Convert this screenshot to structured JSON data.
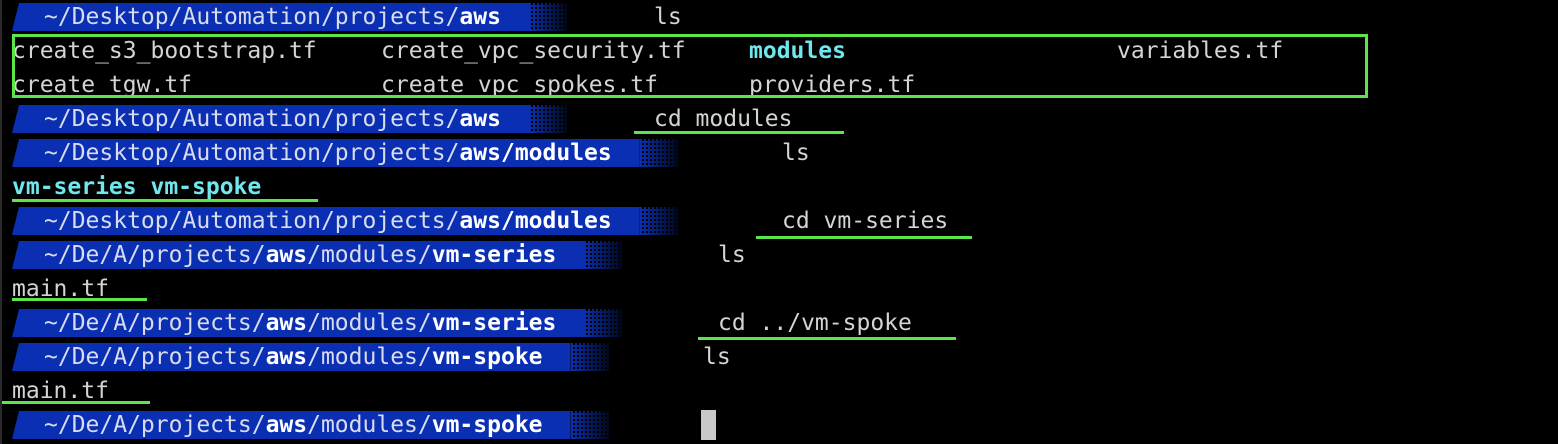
{
  "terminal": {
    "files": {
      "col1": [
        "create_s3_bootstrap.tf",
        "create_tgw.tf"
      ],
      "col2": [
        "create_vpc_security.tf",
        "create_vpc_spokes.tf"
      ],
      "col3_dir": "modules",
      "col3_file": "providers.tf",
      "col4": "variables.tf"
    },
    "path": {
      "home": "~/Desktop/Automation/projects/",
      "home_short": "~/De/A/projects/",
      "aws": "aws",
      "modules_sep": "/modules",
      "modules_slash": "/modules/",
      "vm_series": "vm-series",
      "vm_spoke": "vm-spoke"
    },
    "commands": {
      "ls": "ls",
      "cd_modules": "cd modules",
      "cd_vm_series": "cd vm-series",
      "cd_vm_spoke": "cd ../vm-spoke"
    },
    "outputs": {
      "modules_dirs": "vm-series vm-spoke",
      "vm_series_files": "main.tf",
      "vm_spoke_files": "main.tf"
    }
  },
  "colors": {
    "prompt_bg": "#0a2fb2",
    "directory": "#6ee7ef",
    "highlight": "#5ae64a",
    "cursor": "#c8c8c8"
  }
}
